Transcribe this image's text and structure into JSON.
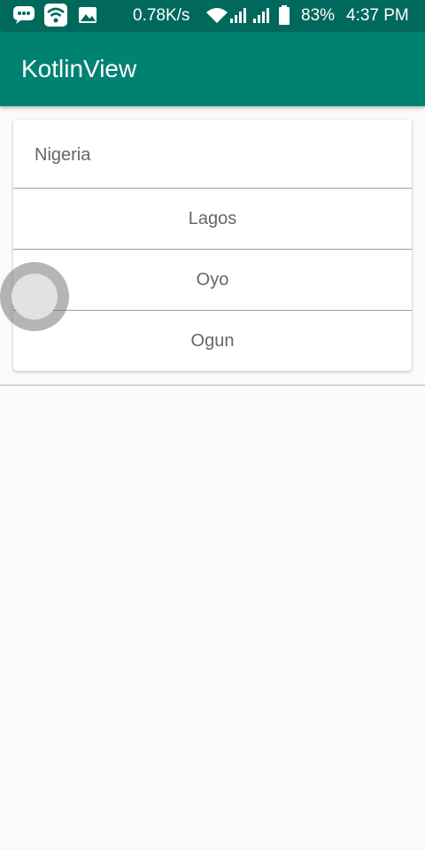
{
  "status_bar": {
    "network_speed": "0.78K/s",
    "battery_percent": "83%",
    "time": "4:37 PM",
    "icons": [
      "chat-notification-icon",
      "wifi-notification-icon",
      "image-notification-icon",
      "wifi-signal-icon",
      "cell-signal-icon",
      "cell-signal-icon-2",
      "battery-icon"
    ]
  },
  "app_bar": {
    "title": "KotlinView"
  },
  "card": {
    "header": "Nigeria",
    "items": [
      {
        "label": "Lagos"
      },
      {
        "label": "Oyo"
      },
      {
        "label": "Ogun"
      }
    ]
  },
  "colors": {
    "status_bar": "#00695c",
    "app_bar": "#008272",
    "background": "#fafafa",
    "text_secondary": "#666666"
  }
}
